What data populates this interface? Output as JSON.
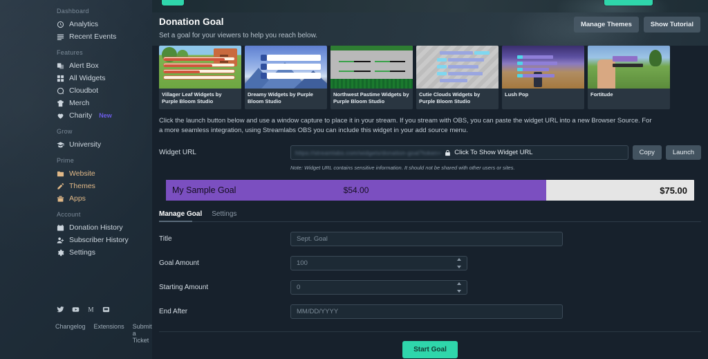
{
  "sidebar": {
    "sections": [
      {
        "label": "Dashboard",
        "items": [
          {
            "label": "Analytics",
            "icon": "analytics-icon",
            "prime": false,
            "badge": ""
          },
          {
            "label": "Recent Events",
            "icon": "list-icon",
            "prime": false,
            "badge": ""
          }
        ]
      },
      {
        "label": "Features",
        "items": [
          {
            "label": "Alert Box",
            "icon": "alert-box-icon",
            "prime": false,
            "badge": ""
          },
          {
            "label": "All Widgets",
            "icon": "grid-icon",
            "prime": false,
            "badge": ""
          },
          {
            "label": "Cloudbot",
            "icon": "cloudbot-icon",
            "prime": false,
            "badge": ""
          },
          {
            "label": "Merch",
            "icon": "merch-icon",
            "prime": false,
            "badge": ""
          },
          {
            "label": "Charity",
            "icon": "heart-icon",
            "prime": false,
            "badge": "New"
          }
        ]
      },
      {
        "label": "Grow",
        "items": [
          {
            "label": "University",
            "icon": "graduation-cap-icon",
            "prime": false,
            "badge": ""
          }
        ]
      },
      {
        "label": "Prime",
        "items": [
          {
            "label": "Website",
            "icon": "website-icon",
            "prime": true,
            "badge": ""
          },
          {
            "label": "Themes",
            "icon": "themes-icon",
            "prime": true,
            "badge": ""
          },
          {
            "label": "Apps",
            "icon": "apps-icon",
            "prime": true,
            "badge": ""
          }
        ]
      },
      {
        "label": "Account",
        "items": [
          {
            "label": "Donation History",
            "icon": "donation-history-icon",
            "prime": false,
            "badge": ""
          },
          {
            "label": "Subscriber History",
            "icon": "subscriber-history-icon",
            "prime": false,
            "badge": ""
          },
          {
            "label": "Settings",
            "icon": "gear-icon",
            "prime": false,
            "badge": ""
          }
        ]
      }
    ],
    "social": [
      "twitter-icon",
      "youtube-icon",
      "medium-icon",
      "discord-icon"
    ],
    "footer_links": [
      "Changelog",
      "Extensions",
      "Submit a Ticket"
    ]
  },
  "header": {
    "title": "Donation Goal",
    "subtitle": "Set a goal for your viewers to help you reach below.",
    "manage_themes_label": "Manage Themes",
    "show_tutorial_label": "Show Tutorial"
  },
  "themes": [
    {
      "label": "Villager Leaf Widgets by Purple Bloom Studio",
      "art": "t1"
    },
    {
      "label": "Dreamy Widgets by Purple Bloom Studio",
      "art": "t2"
    },
    {
      "label": "Northwest Pastime Widgets by Purple Bloom Studio",
      "art": "t3"
    },
    {
      "label": "Cutie Clouds Widgets by Purple Bloom Studio",
      "art": "t4"
    },
    {
      "label": "Lush Pop",
      "art": "t5"
    },
    {
      "label": "Fortitude",
      "art": "t6"
    }
  ],
  "description": "Click the launch button below and use a window capture to place it in your stream. If you stream with OBS, you can paste the widget URL into a new Browser Source. For a more seamless integration, using Streamlabs OBS you can include this widget in your add source menu.",
  "widget_url": {
    "label": "Widget URL",
    "masked_value": "https://streamlabs.com/widgets/donation-goal?token=",
    "cta": "Click To Show Widget URL",
    "copy_label": "Copy",
    "launch_label": "Launch",
    "note": "Note: Widget URL contains sensitive information. It should not be shared with other users or sites."
  },
  "goal_preview": {
    "name": "My Sample Goal",
    "current": "$54.00",
    "total": "$75.00",
    "percent": 72,
    "fill_color": "#7b4fc0",
    "track_color": "#e5e5e5"
  },
  "tabs": [
    {
      "label": "Manage Goal",
      "active": true
    },
    {
      "label": "Settings",
      "active": false
    }
  ],
  "form": {
    "title": {
      "label": "Title",
      "placeholder": "Sept. Goal",
      "value": ""
    },
    "goal_amount": {
      "label": "Goal Amount",
      "placeholder": "100",
      "value": ""
    },
    "starting_amount": {
      "label": "Starting Amount",
      "placeholder": "0",
      "value": ""
    },
    "end_after": {
      "label": "End After",
      "placeholder": "MM/DD/YYYY",
      "value": ""
    },
    "submit_label": "Start Goal"
  },
  "colors": {
    "accent_teal": "#2fd6ab",
    "prime_gold": "#e0b887",
    "badge_new": "#6c5ce7",
    "app_bg": "#17212c"
  }
}
